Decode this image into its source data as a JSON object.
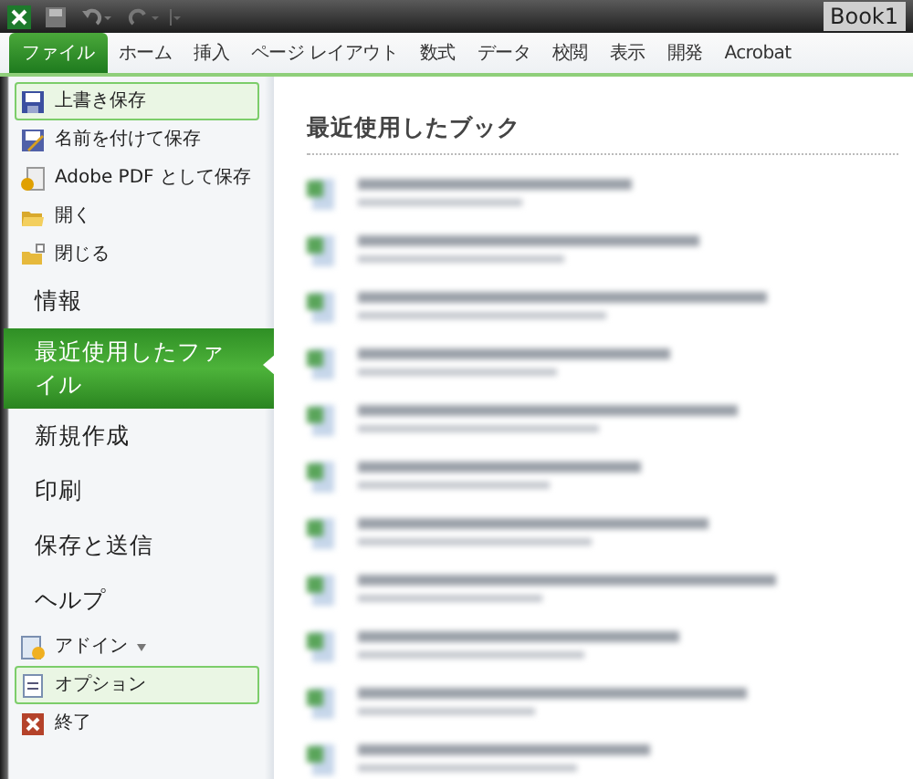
{
  "window": {
    "title": "Book1"
  },
  "tabs": [
    {
      "label": "ファイル",
      "selected": true
    },
    {
      "label": "ホーム",
      "selected": false
    },
    {
      "label": "挿入",
      "selected": false
    },
    {
      "label": "ページ レイアウト",
      "selected": false
    },
    {
      "label": "数式",
      "selected": false
    },
    {
      "label": "データ",
      "selected": false
    },
    {
      "label": "校閲",
      "selected": false
    },
    {
      "label": "表示",
      "selected": false
    },
    {
      "label": "開発",
      "selected": false
    },
    {
      "label": "Acrobat",
      "selected": false
    }
  ],
  "menu": [
    {
      "kind": "command",
      "label": "上書き保存",
      "highlighted": true
    },
    {
      "kind": "command",
      "label": "名前を付けて保存",
      "highlighted": false
    },
    {
      "kind": "command",
      "label": "Adobe PDF として保存",
      "highlighted": false
    },
    {
      "kind": "command",
      "label": "開く",
      "highlighted": false
    },
    {
      "kind": "command",
      "label": "閉じる",
      "highlighted": false
    },
    {
      "kind": "section",
      "label": "情報",
      "selected": false
    },
    {
      "kind": "section",
      "label": "最近使用したファイル",
      "selected": true
    },
    {
      "kind": "section",
      "label": "新規作成",
      "selected": false
    },
    {
      "kind": "section",
      "label": "印刷",
      "selected": false
    },
    {
      "kind": "section",
      "label": "保存と送信",
      "selected": false
    },
    {
      "kind": "section",
      "label": "ヘルプ",
      "selected": false
    },
    {
      "kind": "command",
      "label": "アドイン",
      "highlighted": false
    },
    {
      "kind": "command",
      "label": "オプション",
      "highlighted": true
    },
    {
      "kind": "command",
      "label": "終了",
      "highlighted": false
    }
  ],
  "recent": {
    "heading": "最近使用したブック",
    "files": [
      {
        "kind": "blurred"
      },
      {
        "kind": "blurred"
      },
      {
        "kind": "blurred"
      },
      {
        "kind": "blurred"
      },
      {
        "kind": "blurred"
      },
      {
        "kind": "blurred"
      },
      {
        "kind": "blurred"
      },
      {
        "kind": "blurred"
      },
      {
        "kind": "blurred"
      },
      {
        "kind": "blurred"
      },
      {
        "kind": "blurred"
      }
    ]
  }
}
